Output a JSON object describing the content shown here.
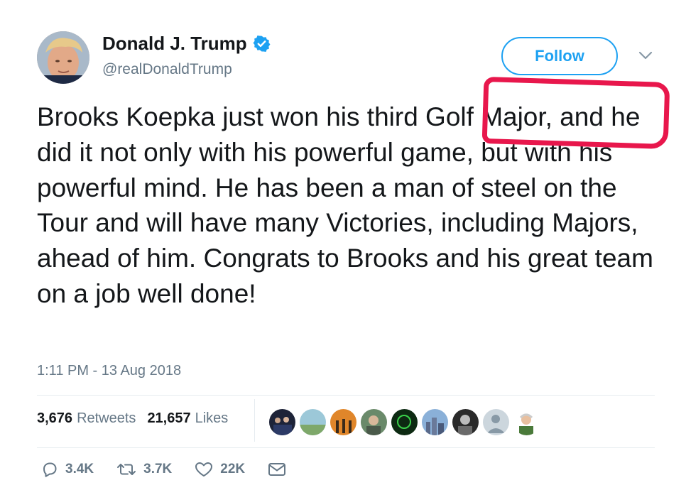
{
  "user": {
    "name": "Donald J. Trump",
    "handle": "@realDonaldTrump",
    "verified": true
  },
  "follow_label": "Follow",
  "tweet": {
    "text": "Brooks Koepka just won his third Golf Major, and he did it not only with his powerful game, but with his powerful mind. He has been a man of steel on the Tour and will have many Victories, including Majors, ahead of him. Congrats to Brooks and his great team on a job well done!",
    "timestamp": "1:11 PM - 13 Aug 2018"
  },
  "stats": {
    "retweets_count": "3,676",
    "retweets_label": "Retweets",
    "likes_count": "21,657",
    "likes_label": "Likes"
  },
  "actions": {
    "replies": "3.4K",
    "retweets": "3.7K",
    "likes": "22K"
  },
  "colors": {
    "accent": "#1da1f2",
    "secondary_text": "#657786",
    "annotation": "#e8174c"
  }
}
